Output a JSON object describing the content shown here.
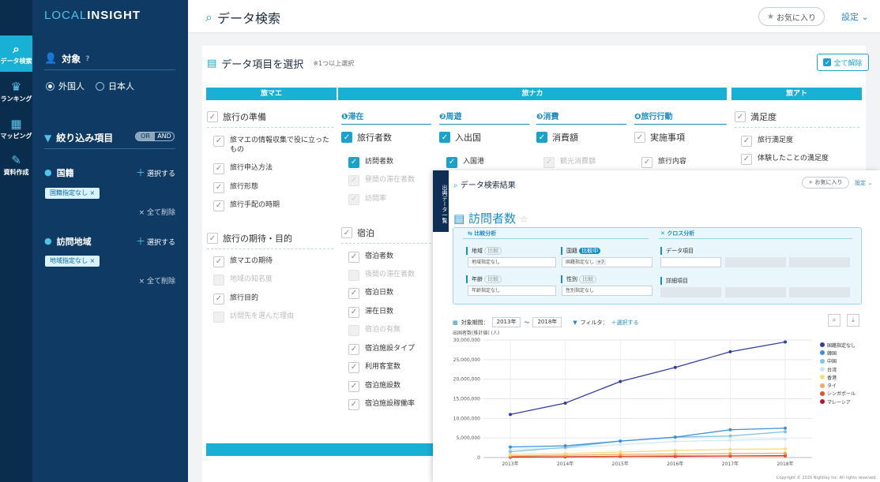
{
  "rail": [
    {
      "icon": "search",
      "label": "データ検索"
    },
    {
      "icon": "crown",
      "label": "ランキング"
    },
    {
      "icon": "map",
      "label": "マッピング"
    },
    {
      "icon": "document",
      "label": "資料作成"
    }
  ],
  "sidebar": {
    "logo_a": "LOCAL",
    "logo_b": "INSIGHT",
    "target_title": "対象",
    "target_options": [
      "外国人",
      "日本人"
    ],
    "filter_title": "絞り込み項目",
    "toggle": [
      "OR",
      "AND"
    ],
    "filters": [
      {
        "label": "国籍",
        "select": "選択する",
        "chip": "国籍指定なし ×",
        "clear": "× 全て削除"
      },
      {
        "label": "訪問地域",
        "select": "選択する",
        "chip": "地域指定なし ×",
        "clear": "× 全て削除"
      }
    ]
  },
  "header": {
    "title": "データ検索",
    "favorite": "お気に入り",
    "settings": "設定"
  },
  "panel": {
    "title": "データ項目を選択",
    "note": "※1つ以上選択",
    "clear_all": "全て解除",
    "phases": [
      "旅マエ",
      "旅ナカ",
      "旅アト"
    ],
    "stages": [
      "❶滞在",
      "❷周遊",
      "❸消費",
      "❹旅行行動"
    ],
    "groups": {
      "prep": {
        "label": "旅行の準備",
        "items": [
          "旅マエの情報収集で役に立ったもの",
          "旅行申込方法",
          "旅行形態",
          "旅行手配の時期"
        ]
      },
      "expect": {
        "label": "旅行の期待・目的",
        "items": [
          "旅マエの期待",
          "地域の知名度",
          "旅行目的",
          "訪問先を選んだ理由"
        ]
      },
      "travelers": {
        "label": "旅行者数",
        "items": [
          "訪問者数",
          "昼間の滞在者数",
          "訪問率"
        ]
      },
      "lodging": {
        "label": "宿泊",
        "items": [
          "宿泊者数",
          "夜間の滞在者数",
          "宿泊日数",
          "滞在日数",
          "宿泊の有無",
          "宿泊施設タイプ",
          "利用客室数",
          "宿泊施設数",
          "宿泊施設稼働率"
        ]
      },
      "entry": {
        "label": "入出国",
        "items": [
          "入国港"
        ]
      },
      "spend": {
        "label": "消費額",
        "items": [
          "観光消費額"
        ]
      },
      "activity": {
        "label": "実施事項",
        "items": [
          "旅行内容"
        ]
      },
      "satisfaction": {
        "label": "満足度",
        "items": [
          "旅行満足度",
          "体験したことの満足度"
        ]
      }
    }
  },
  "overlay": {
    "tab": "出典データ一覧",
    "title": "データ検索結果",
    "favorite": "お気に入り",
    "settings": "設定",
    "metric": "訪問者数",
    "compare_title": "比較分析",
    "cross_title": "クロス分析",
    "compare_fields": [
      {
        "label": "地域",
        "badge": "比較",
        "value": "地域指定なし"
      },
      {
        "label": "国籍",
        "badge": "比較中",
        "value": "国籍指定なし",
        "extra": "+7"
      },
      {
        "label": "年齢",
        "badge": "比較",
        "value": "年齢指定なし"
      },
      {
        "label": "性別",
        "badge": "比較",
        "value": "性別指定なし"
      }
    ],
    "cross_fields": [
      "データ項目",
      "詳細項目"
    ],
    "period_label": "対象期間：",
    "period_from": "2013年",
    "period_to": "2018年",
    "tilde": "〜",
    "filter_label": "フィルタ：",
    "filter_select": "選択する",
    "copyright": "Copyright © 2020 Nightley Inc. All rights reserved."
  },
  "chart_data": {
    "type": "line",
    "ylabel": "出国者数(推計値) (人)",
    "x": [
      "2013年",
      "2014年",
      "2015年",
      "2016年",
      "2017年",
      "2018年"
    ],
    "ylim": [
      0,
      30000000
    ],
    "yticks": [
      "30,000,000",
      "25,000,000",
      "20,000,000",
      "15,000,000",
      "10,000,000",
      "5,000,000",
      "0"
    ],
    "grid": true,
    "legend": "right",
    "series": [
      {
        "name": "国籍指定なし",
        "color": "#2f3f9e",
        "values": [
          11000000,
          13900000,
          19400000,
          23000000,
          27000000,
          29500000
        ]
      },
      {
        "name": "韓国",
        "color": "#3f8fd8",
        "values": [
          2700000,
          3000000,
          4200000,
          5200000,
          7100000,
          7500000
        ]
      },
      {
        "name": "中国",
        "color": "#7fc3ec",
        "values": [
          1500000,
          2600000,
          4200000,
          5200000,
          5500000,
          6600000
        ]
      },
      {
        "name": "台湾",
        "color": "#cde8f7",
        "values": [
          2100000,
          2400000,
          3300000,
          4100000,
          4400000,
          4700000
        ]
      },
      {
        "name": "香港",
        "color": "#f9dd7c",
        "values": [
          800000,
          1000000,
          1400000,
          1800000,
          2100000,
          2200000
        ]
      },
      {
        "name": "タイ",
        "color": "#f6a75a",
        "values": [
          400000,
          600000,
          800000,
          900000,
          1000000,
          1100000
        ]
      },
      {
        "name": "シンガポール",
        "color": "#e2502e",
        "values": [
          200000,
          200000,
          300000,
          400000,
          400000,
          400000
        ]
      },
      {
        "name": "マレーシア",
        "color": "#b8122c",
        "values": [
          100000,
          200000,
          300000,
          300000,
          400000,
          500000
        ]
      }
    ]
  }
}
